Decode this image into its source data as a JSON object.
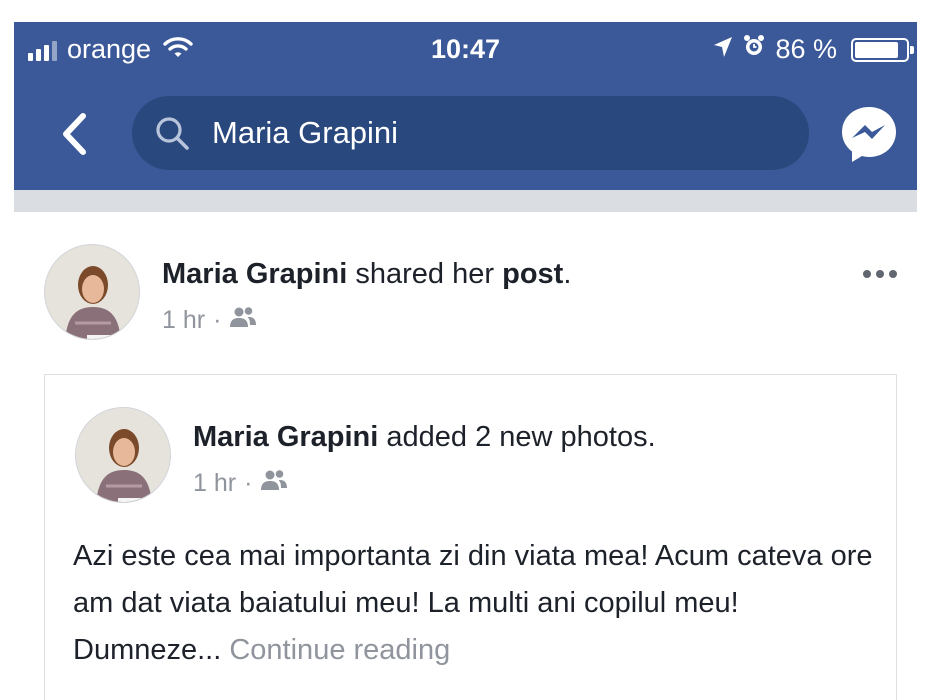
{
  "status_bar": {
    "carrier": "orange",
    "time": "10:47",
    "battery": "86 %",
    "battery_level": 0.86
  },
  "nav": {
    "search_query": "Maria Grapini",
    "icons": [
      "back-chevron-icon",
      "search-icon",
      "messenger-icon"
    ]
  },
  "post": {
    "author": "Maria Grapini",
    "action_text": "shared her",
    "action_object": "post",
    "time": "1 hr",
    "audience_icon": "friends-icon",
    "shared": {
      "author": "Maria Grapini",
      "action_text": "added 2 new photos.",
      "time": "1 hr",
      "audience_icon": "friends-icon",
      "text": "Azi este cea mai importanta zi din viata mea! Acum cateva ore am dat viata baiatului meu! La multi ani copilul meu! Dumneze...",
      "continue_label": "Continue reading"
    }
  },
  "colors": {
    "header_blue": "#3b5998",
    "search_bg": "#29487d",
    "text": "#1d2129",
    "muted": "#90949c"
  }
}
